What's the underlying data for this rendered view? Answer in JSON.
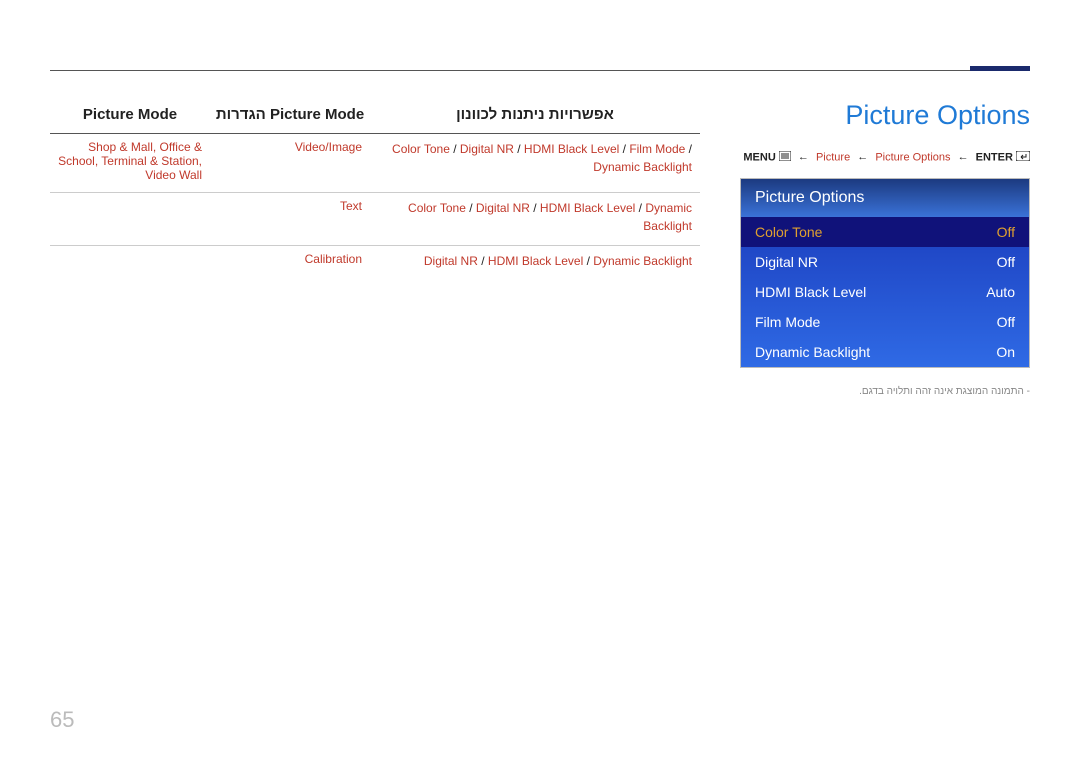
{
  "page_number": "65",
  "title": "Picture Options",
  "breadcrumb": {
    "enter": "ENTER",
    "item1": "Picture Options",
    "item2": "Picture",
    "menu": "MENU"
  },
  "panel": {
    "header": "Picture Options",
    "rows": [
      {
        "label": "Color Tone",
        "value": "Off",
        "selected": true
      },
      {
        "label": "Digital NR",
        "value": "Off",
        "selected": false
      },
      {
        "label": "HDMI Black Level",
        "value": "Auto",
        "selected": false
      },
      {
        "label": "Film Mode",
        "value": "Off",
        "selected": false
      },
      {
        "label": "Dynamic Backlight",
        "value": "On",
        "selected": false
      }
    ]
  },
  "footnote": "-   התמונה המוצגת אינה זהה ותלויה בדגם.",
  "table": {
    "headers": {
      "col1": "Picture Mode",
      "col2": "הגדרות Picture Mode",
      "col3": "אפשרויות ניתנות לכוונון"
    },
    "rows": [
      {
        "c1": "Shop & Mall, Office & School, Terminal & Station, Video Wall",
        "c2": "Video/Image",
        "c3": "Color Tone / Digital NR / HDMI Black Level / Film Mode / Dynamic Backlight"
      },
      {
        "c1": "",
        "c2": "Text",
        "c3": "Color Tone / Digital NR / HDMI Black Level / Dynamic Backlight"
      },
      {
        "c1": "",
        "c2": "Calibration",
        "c3": "Digital NR / HDMI Black Level / Dynamic Backlight"
      }
    ]
  }
}
